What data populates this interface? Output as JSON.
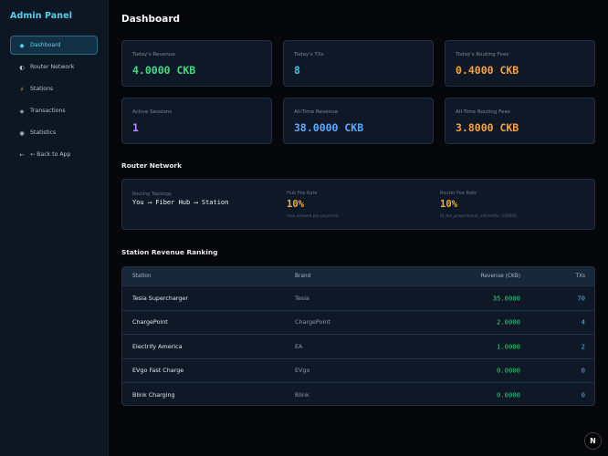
{
  "sidebar": {
    "brand": "Admin Panel",
    "items": [
      {
        "icon": "◆",
        "label": "Dashboard"
      },
      {
        "icon": "◐",
        "label": "Router Network"
      },
      {
        "icon": "⚡",
        "label": "Stations"
      },
      {
        "icon": "◈",
        "label": "Transactions"
      },
      {
        "icon": "◉",
        "label": "Statistics"
      },
      {
        "icon": "←",
        "label": "← Back to App"
      }
    ]
  },
  "page_title": "Dashboard",
  "cards": [
    {
      "label": "Today's Revenue",
      "value": "4.0000 CKB",
      "color": "#3ddc84"
    },
    {
      "label": "Today's TXs",
      "value": "8",
      "color": "#33c1e5"
    },
    {
      "label": "Today's Routing Fees",
      "value": "0.4000 CKB",
      "color": "#f6a23a"
    },
    {
      "label": "Active Sessions",
      "value": "1",
      "color": "#b58cff"
    },
    {
      "label": "All-Time Revenue",
      "value": "38.0000 CKB",
      "color": "#5ca8ff"
    },
    {
      "label": "All-Time Routing Fees",
      "value": "3.8000 CKB",
      "color": "#f6a23a"
    }
  ],
  "router": {
    "section_title": "Router Network",
    "topology_label": "Routing Topology",
    "topology_value": "You ⟶ Fiber Hub ⟶ Station",
    "hub_fee_label": "Hub Fee Rate",
    "hub_fee_value": "10%",
    "hub_fee_note": "max allowed per payment",
    "router_fee_label": "Router Fee Rate",
    "router_fee_value": "10%",
    "router_fee_note": "fd_fee_proportional_millionths: 100000"
  },
  "ranking": {
    "section_title": "Station Revenue Ranking",
    "headers": {
      "station": "Station",
      "brand": "Brand",
      "revenue": "Revenue (CKB)",
      "txs": "TXs"
    },
    "rows": [
      {
        "station": "Tesla Supercharger",
        "brand": "Tesla",
        "revenue": "35.0000",
        "txs": "70"
      },
      {
        "station": "ChargePoint",
        "brand": "ChargePoint",
        "revenue": "2.0000",
        "txs": "4"
      },
      {
        "station": "Electrify America",
        "brand": "EA",
        "revenue": "1.0000",
        "txs": "2"
      },
      {
        "station": "EVgo Fast Charge",
        "brand": "EVgo",
        "revenue": "0.0000",
        "txs": "0"
      },
      {
        "station": "Blink Charging",
        "brand": "Blink",
        "revenue": "0.0000",
        "txs": "0"
      }
    ]
  },
  "fab_label": "N"
}
